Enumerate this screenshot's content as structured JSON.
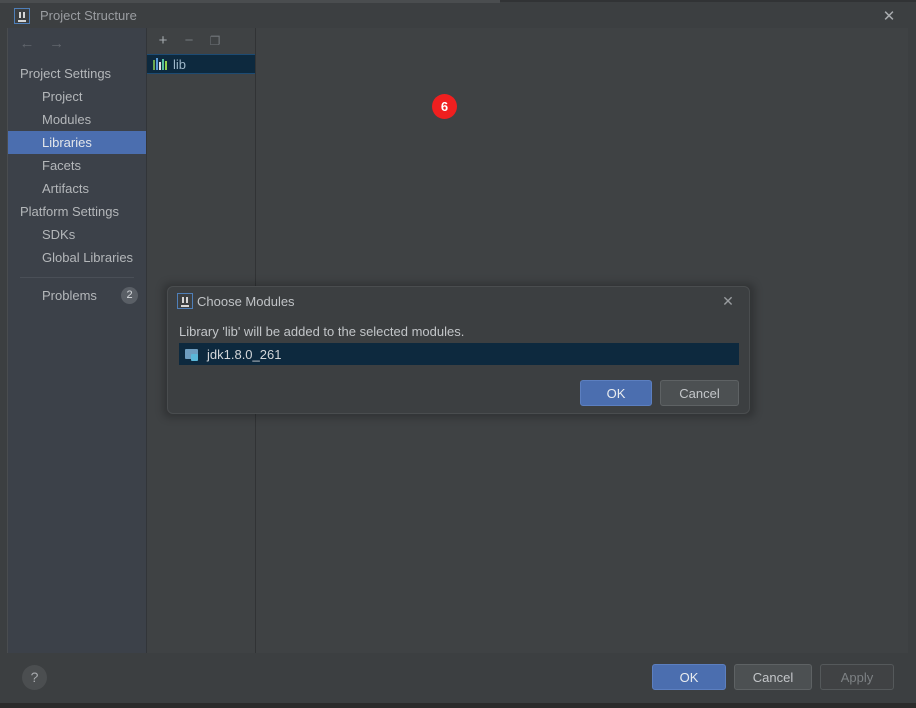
{
  "window": {
    "title": "Project Structure",
    "icon": "intellij-idea-icon",
    "close_label": "✕"
  },
  "nav": {
    "back_icon": "←",
    "forward_icon": "→"
  },
  "sidebar": {
    "groups": [
      {
        "label": "Project Settings",
        "items": [
          {
            "label": "Project",
            "selected": false
          },
          {
            "label": "Modules",
            "selected": false
          },
          {
            "label": "Libraries",
            "selected": true
          },
          {
            "label": "Facets",
            "selected": false
          },
          {
            "label": "Artifacts",
            "selected": false
          }
        ]
      },
      {
        "label": "Platform Settings",
        "items": [
          {
            "label": "SDKs",
            "selected": false
          },
          {
            "label": "Global Libraries",
            "selected": false
          }
        ]
      }
    ],
    "problems": {
      "label": "Problems",
      "count": "2"
    }
  },
  "libraries_panel": {
    "toolbar": {
      "add_label": "+",
      "remove_label": "−",
      "copy_label": "❐"
    },
    "items": [
      {
        "label": "lib",
        "icon": "library-icon",
        "selected": true
      }
    ]
  },
  "footer": {
    "help_label": "?",
    "ok_label": "OK",
    "cancel_label": "Cancel",
    "apply_label": "Apply"
  },
  "dialog": {
    "title": "Choose Modules",
    "icon": "intellij-idea-icon",
    "close_label": "✕",
    "message": "Library 'lib' will be added to the selected modules.",
    "modules": [
      {
        "label": "jdk1.8.0_261",
        "icon": "module-icon",
        "selected": true
      }
    ],
    "ok_label": "OK",
    "cancel_label": "Cancel",
    "click_badge": "6"
  },
  "colors": {
    "accent_blue": "#4b6eaf",
    "selection_dark_blue": "#0d293e",
    "badge_red": "#f01f1f",
    "window_bg": "#3c3f41",
    "panel_bg": "#3f4244",
    "sidebar_bg": "#3c4149"
  }
}
